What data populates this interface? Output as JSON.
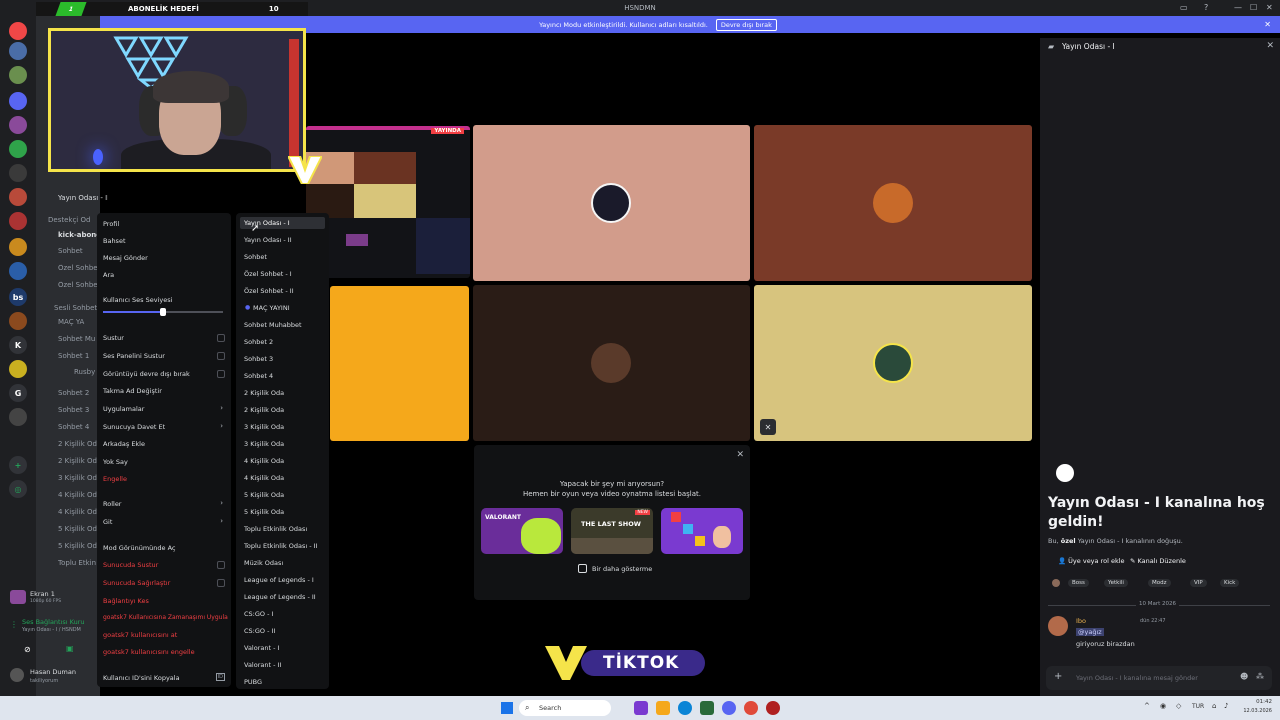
{
  "window": {
    "title": "HSNDMN",
    "controls": [
      "—",
      "☐",
      "✕"
    ]
  },
  "subgoal": {
    "label": "ABONELİK HEDEFİ",
    "current": "1",
    "target": "10"
  },
  "banner": {
    "text": "Yayıncı Modu etkinleştirildi. Kullanıcı adları kısaltıldı.",
    "button": "Devre dışı bırak"
  },
  "servers": [
    "bs",
    "K",
    "G"
  ],
  "channels": {
    "voice_top": "Yayın Odası - II",
    "items": [
      "Destekçi Od",
      "kick-abone",
      "Sohbet",
      "Özel Sohbe",
      "Özel Sohbe",
      "Sesli Sohbet",
      "MAÇ YA",
      "Sohbet Mu",
      "Sohbet 1",
      "Rusby",
      "Sohbet 2",
      "Sohbet 3",
      "Sohbet 4",
      "2 Kişilik Od",
      "2 Kişilik Od",
      "3 Kişilik Od",
      "4 Kişilik Od",
      "4 Kişilik Od",
      "5 Kişilik Od",
      "5 Kişilik Od",
      "Toplu Etkin"
    ],
    "screen_share": "Ekran 1",
    "screen_sub": "1080p 60 FPS",
    "voice_status": "Ses Bağlantısı Kuru",
    "voice_status_sub": "Yayın Odası - I / HSNDM",
    "user_name": "Hasan Duman",
    "user_status": "takiliyorum"
  },
  "stream": {
    "live_badge": "YAYINDA"
  },
  "context_menu": {
    "items": [
      "Profil",
      "Bahset",
      "Mesaj Gönder",
      "Ara"
    ],
    "volume_label": "Kullanıcı Ses Seviyesi",
    "volume_level": 0.5,
    "toggles": [
      "Sustur",
      "Ses Panelini Sustur",
      "Görüntüyü devre dışı bırak"
    ],
    "items2": [
      "Takma Ad Değiştir",
      "Uygulamalar",
      "Sunucuya Davet Et",
      "Arkadaş Ekle",
      "Yok Say"
    ],
    "block": "Engelle",
    "items3": [
      "Roller",
      "Git"
    ],
    "mod_view": "Mod Görünümünde Aç",
    "server_mute": "Sunucuda Sustur",
    "server_deafen": "Sunucuda Sağırlaştır",
    "disconnect": "Bağlantıyı Kes",
    "timeout": "goatsk7 Kullanıcısına Zamanaşımı Uygula",
    "kick": "goatsk7 kullanıcısını at",
    "ban": "goatsk7 kullanıcısını engelle",
    "copy_id": "Kullanıcı ID'sini Kopyala",
    "id_badge": "ID"
  },
  "move_menu": {
    "items": [
      "Yayın Odası - I",
      "Yayın Odası - II",
      "Sohbet",
      "Özel Sohbet - I",
      "Özel Sohbet - II",
      "MAÇ YAYINI",
      "Sohbet Muhabbet",
      "Sohbet 2",
      "Sohbet 3",
      "Sohbet 4",
      "2 Kişilik Oda",
      "2 Kişilik Oda",
      "3 Kişilik Oda",
      "3 Kişilik Oda",
      "4 Kişilik Oda",
      "4 Kişilik Oda",
      "5 Kişilik Oda",
      "5 Kişilik Oda",
      "Toplu Etkinlik Odası",
      "Toplu Etkinlik Odası - II",
      "Müzik Odası",
      "League of Legends - I",
      "League of Legends - II",
      "CS:GO - I",
      "CS:GO - II",
      "Valorant - I",
      "Valorant - II",
      "PUBG"
    ]
  },
  "activity": {
    "line1": "Yapacak bir şey mi arıyorsun?",
    "line2": "Hemen bir oyun veya video oynatma listesi başlat.",
    "dont_show": "Bir daha gösterme",
    "games": [
      "VALORANT",
      "THE LAST SHOW",
      "NEW"
    ]
  },
  "sidebar": {
    "header": "Yayın Odası - I",
    "welcome": "Yayın Odası - I kanalına hoş geldin!",
    "desc_pre": "Bu,",
    "desc_bold": "özel",
    "desc_post": "Yayın Odası - I kanalının doğuşu.",
    "btn_role": "Üye veya rol ekle",
    "btn_edit": "Kanalı Düzenle",
    "roles": [
      "Boss",
      "Yetkili",
      "Modz",
      "VIP",
      "Kick"
    ],
    "date": "10 Mart 2026",
    "msg_author": "Ibo",
    "msg_time": "dün 22:47",
    "msg_mention": "@yağız",
    "msg_text": "giriyoruz birazdan",
    "input_placeholder": "Yayın Odası - I kanalına mesaj gönder"
  },
  "overlay": {
    "tiktok": "TİKTOK"
  },
  "taskbar": {
    "search": "Search",
    "lang": "TUR",
    "time": "01:42",
    "date": "12.03.2026"
  },
  "colors": {
    "accent": "#5865f2",
    "yellow": "#f5e44a",
    "danger": "#f23f43"
  }
}
